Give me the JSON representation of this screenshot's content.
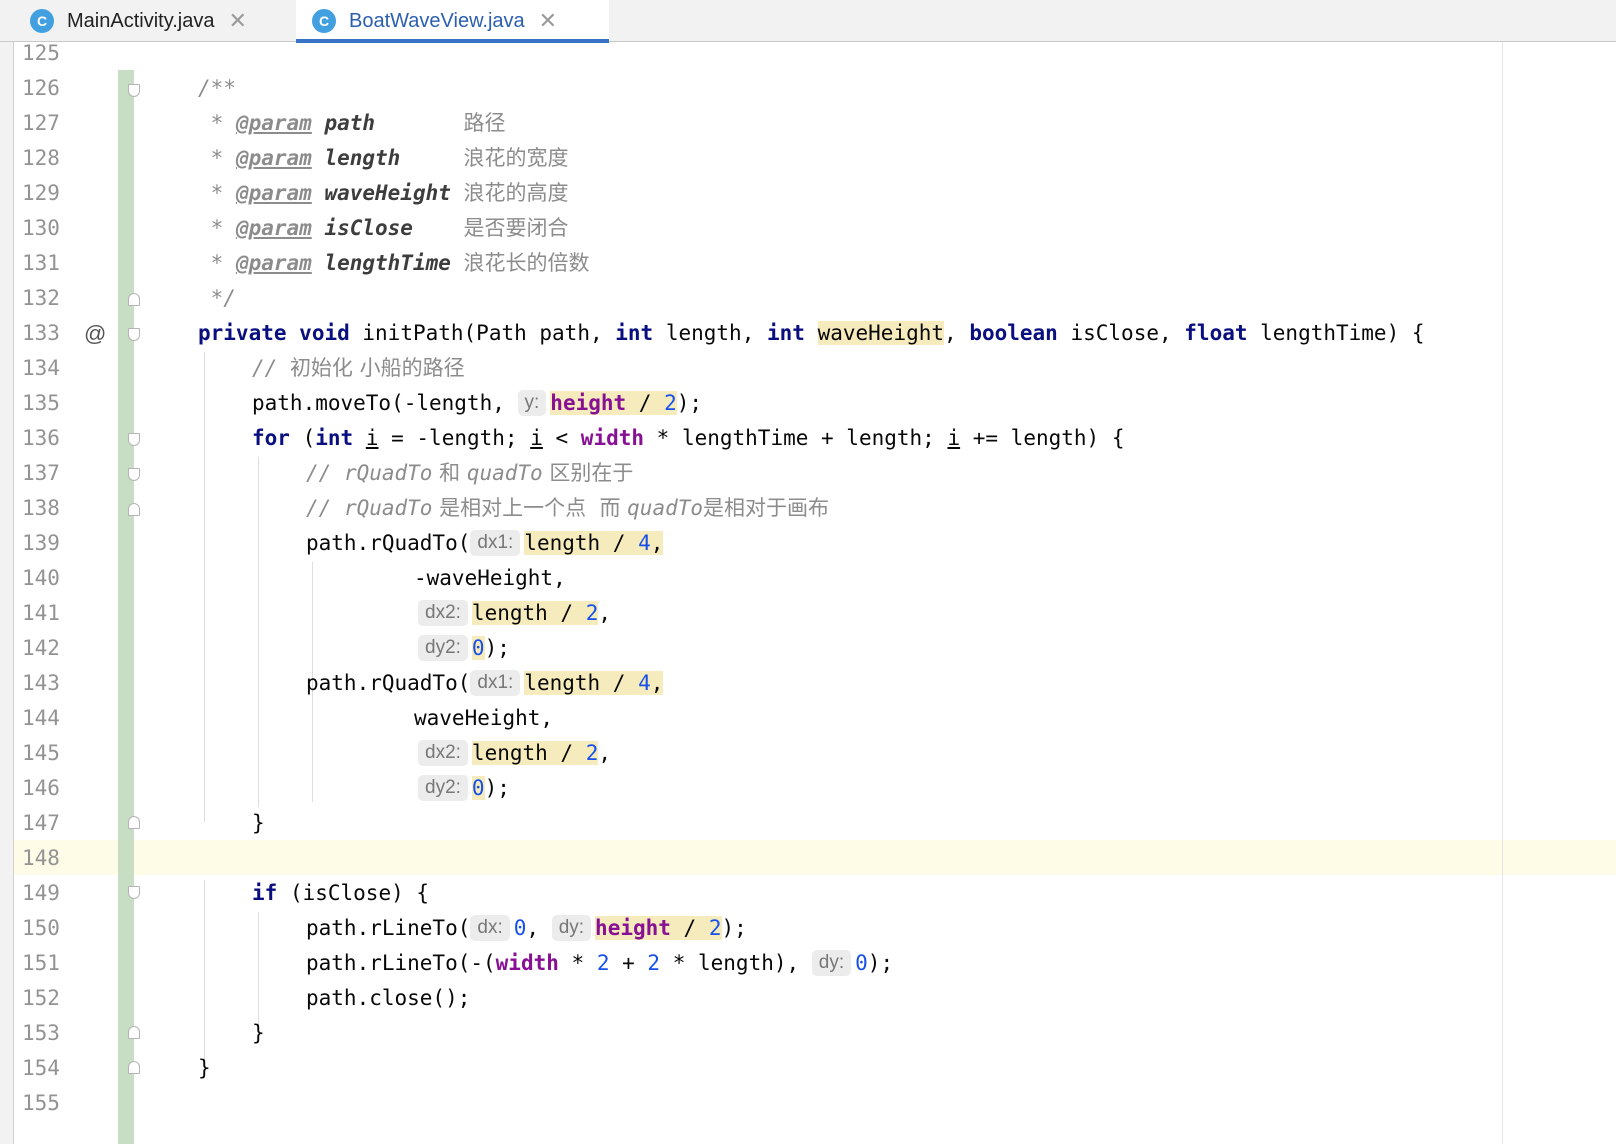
{
  "tabs": [
    {
      "icon": "C",
      "label": "MainActivity.java",
      "close": "✕",
      "active": false
    },
    {
      "icon": "C",
      "label": "BoatWaveView.java",
      "close": "✕",
      "active": true
    }
  ],
  "gutter": {
    "line_numbers": [
      "125",
      "126",
      "127",
      "128",
      "129",
      "130",
      "131",
      "132",
      "133",
      "134",
      "135",
      "136",
      "137",
      "138",
      "139",
      "140",
      "141",
      "142",
      "143",
      "144",
      "145",
      "146",
      "147",
      "148",
      "149",
      "150",
      "151",
      "152",
      "153",
      "154",
      "155"
    ],
    "override_marker": "@"
  },
  "code": {
    "l126": "/**",
    "l127": {
      "star": " * ",
      "tag": "@param",
      "name": "path",
      "pad": "       ",
      "desc": "路径"
    },
    "l128": {
      "star": " * ",
      "tag": "@param",
      "name": "length",
      "pad": "     ",
      "desc": "浪花的宽度"
    },
    "l129": {
      "star": " * ",
      "tag": "@param",
      "name": "waveHeight",
      "pad": " ",
      "desc": "浪花的高度"
    },
    "l130": {
      "star": " * ",
      "tag": "@param",
      "name": "isClose",
      "pad": "    ",
      "desc": "是否要闭合"
    },
    "l131": {
      "star": " * ",
      "tag": "@param",
      "name": "lengthTime",
      "pad": " ",
      "desc": "浪花长的倍数"
    },
    "l132": " */",
    "l133": {
      "private": "private",
      "void": "void",
      "sig_a": " initPath(Path path, ",
      "int1": "int",
      "sig_b": " length, ",
      "int2": "int",
      "sp": " ",
      "waveHeight": "waveHeight",
      "sig_c": ", ",
      "boolean": "boolean",
      "sig_d": " isClose, ",
      "float": "float",
      "sig_e": " lengthTime) {"
    },
    "l134": {
      "slashes": "// ",
      "text": "初始化 小船的路径"
    },
    "l135": {
      "pre": "path.moveTo(-length, ",
      "hint": "y:",
      "height": "height",
      "div": " / ",
      "num": "2",
      "post": ");"
    },
    "l136": {
      "for": "for",
      "a": " (",
      "int": "int",
      "sp": " ",
      "i1": "i",
      "b": " = -length; ",
      "i2": "i",
      "c": " < ",
      "width": "width",
      "d": " * lengthTime + length; ",
      "i3": "i",
      "e": " += length) {"
    },
    "l137": {
      "c1": "// ",
      "q1": "rQuadTo",
      "c2": " 和 ",
      "q2": "quadTo",
      "c3": " 区别在于"
    },
    "l138": {
      "c1": "// ",
      "q1": "rQuadTo",
      "c2": " 是相对上一个点  而 ",
      "q2": "quadTo",
      "c3": "是相对于画布"
    },
    "l139": {
      "pre": "path.rQuadTo(",
      "hint": "dx1:",
      "arg": "length / ",
      "num": "4",
      "post": ","
    },
    "l140": "-waveHeight,",
    "l141": {
      "hint": "dx2:",
      "arg": "length / ",
      "num": "2",
      "post": ","
    },
    "l142": {
      "hint": "dy2:",
      "num": "0",
      "post": ");"
    },
    "l143": {
      "pre": "path.rQuadTo(",
      "hint": "dx1:",
      "arg": "length / ",
      "num": "4",
      "post": ","
    },
    "l144": "waveHeight,",
    "l145": {
      "hint": "dx2:",
      "arg": "length / ",
      "num": "2",
      "post": ","
    },
    "l146": {
      "hint": "dy2:",
      "num": "0",
      "post": ");"
    },
    "l147": "}",
    "l149": {
      "if": "if",
      "rest": " (isClose) {"
    },
    "l150": {
      "pre": "path.rLineTo(",
      "hint1": "dx:",
      "num1": "0",
      "mid": ", ",
      "hint2": "dy:",
      "height": "height",
      "div": " / ",
      "num2": "2",
      "post": ");"
    },
    "l151": {
      "pre": "path.rLineTo(-(",
      "width": "width",
      "a": " * ",
      "n1": "2",
      "b": " + ",
      "n2": "2",
      "c": " * length), ",
      "hint": "dy:",
      "n3": "0",
      "post": ");"
    },
    "l152": "path.close();",
    "l153": "}",
    "l154": "}"
  }
}
